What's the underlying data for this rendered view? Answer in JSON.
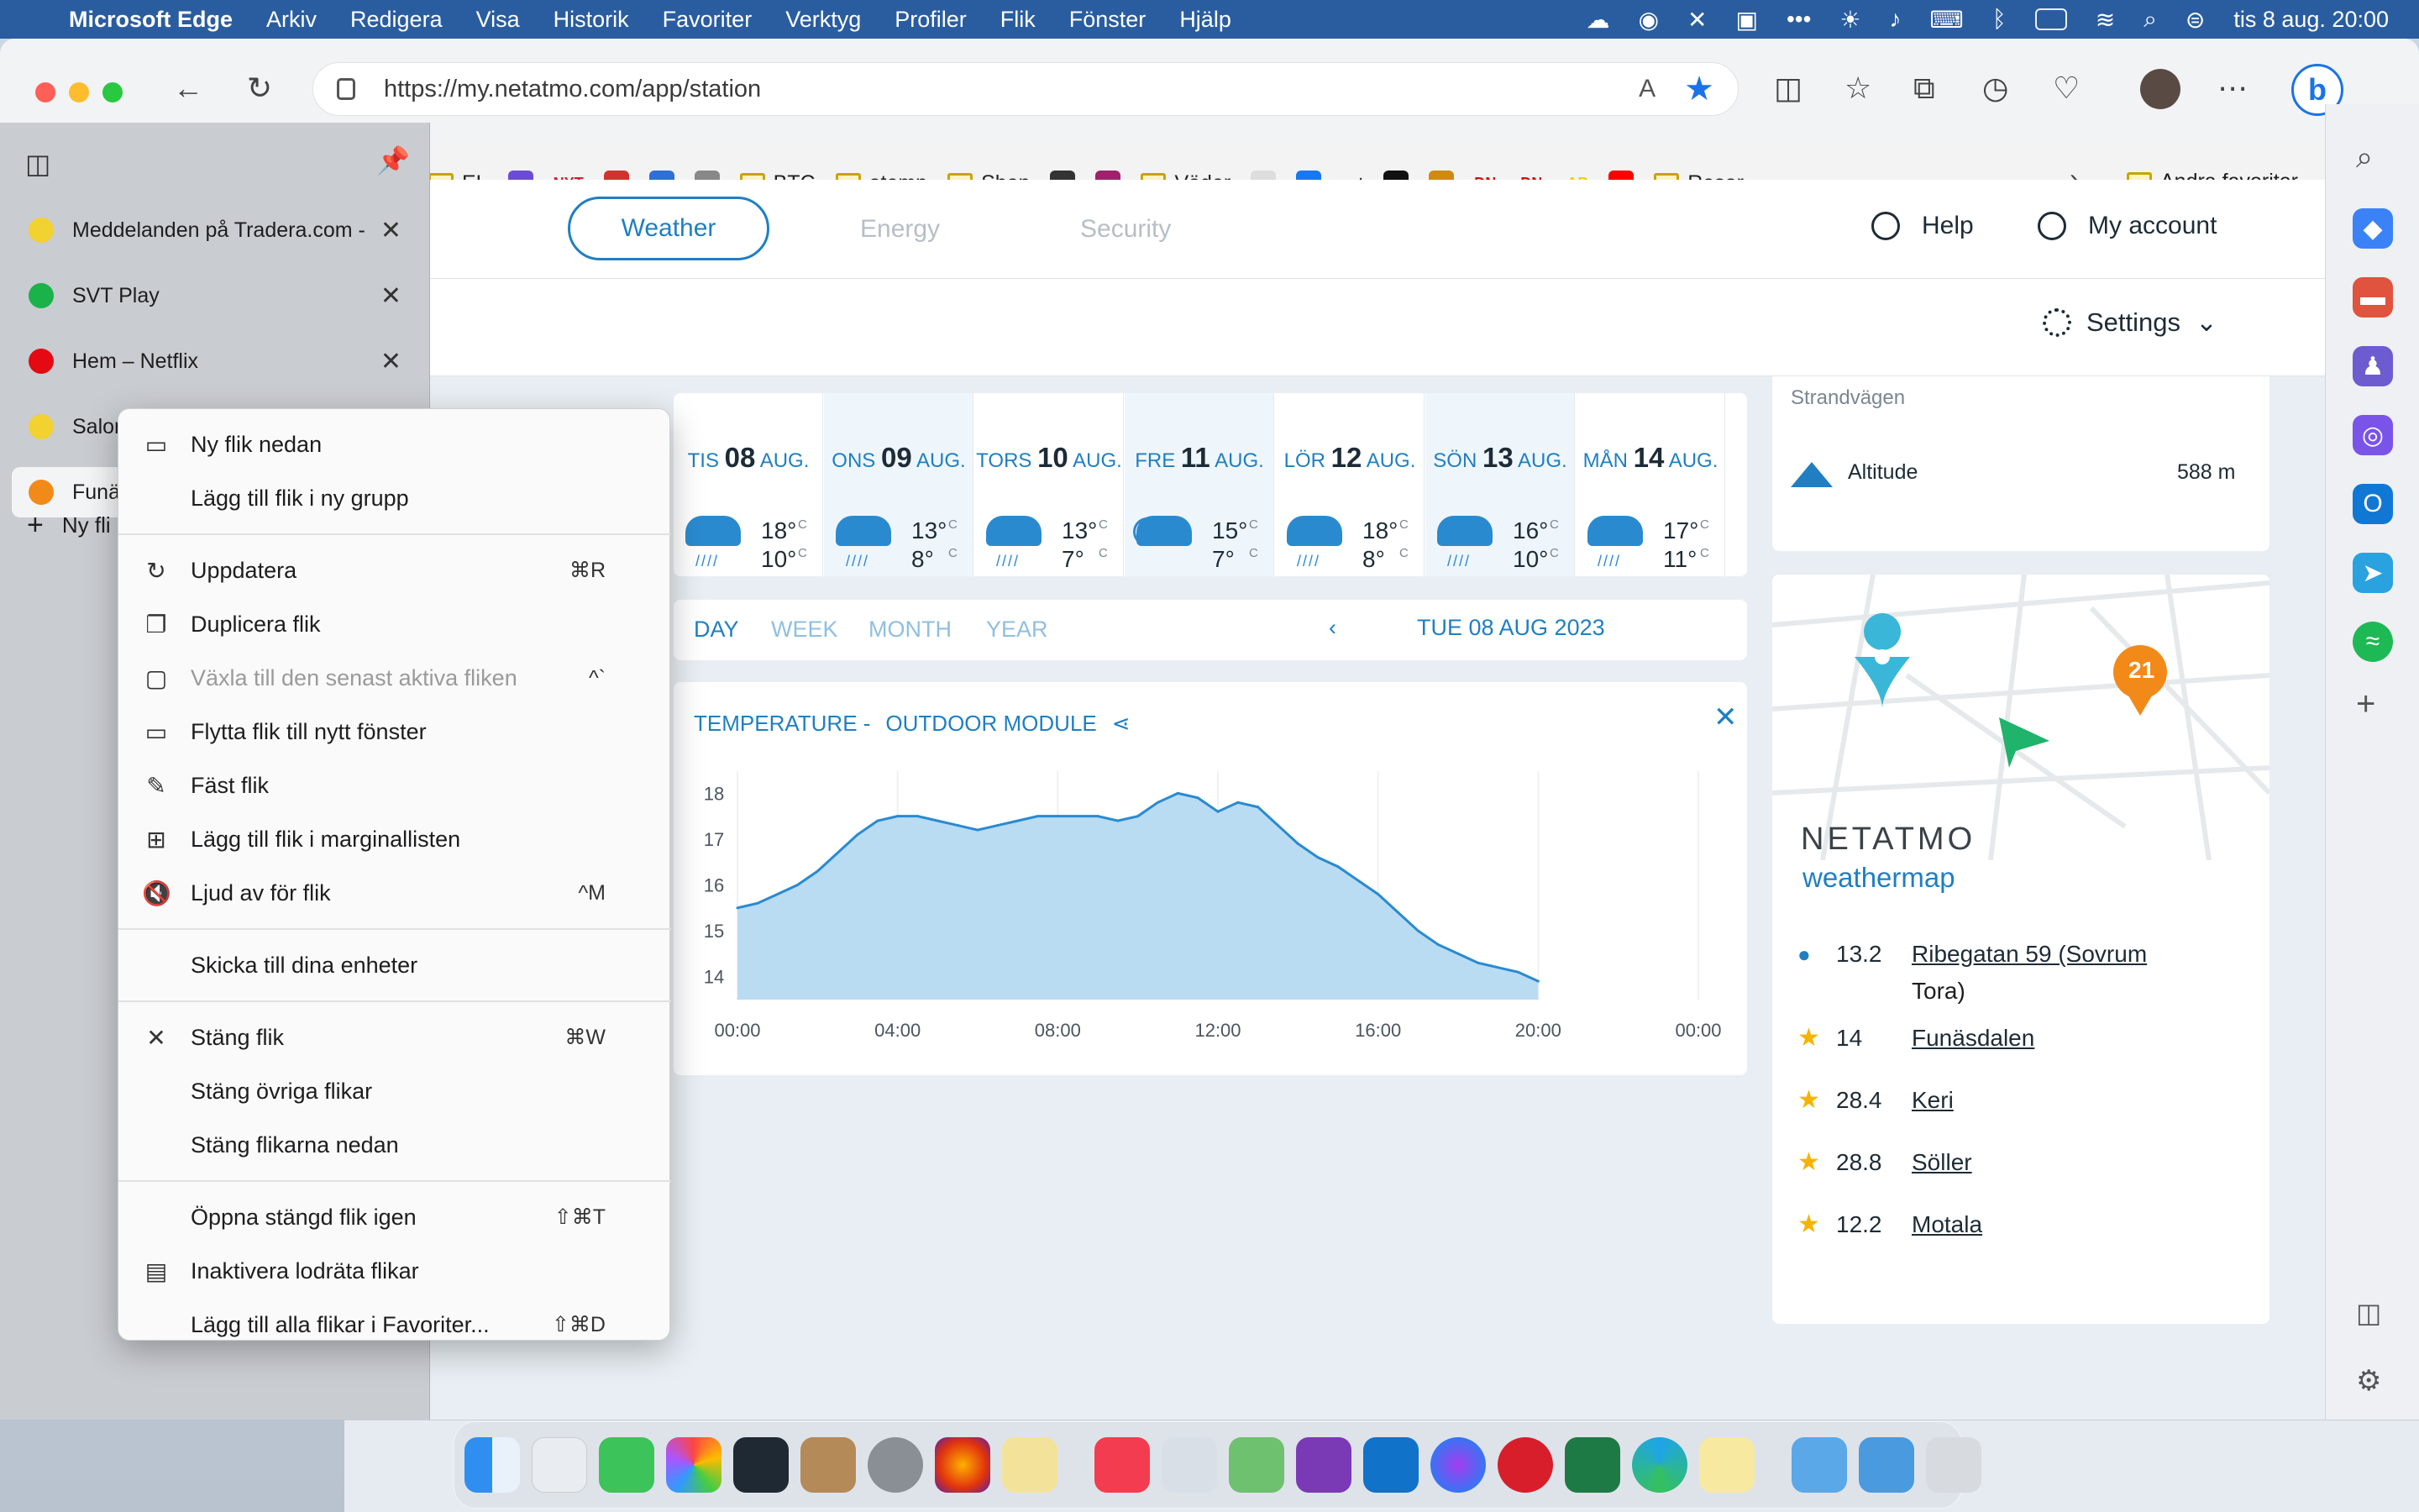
{
  "menubar": {
    "app_name": "Microsoft Edge",
    "items": [
      "Arkiv",
      "Redigera",
      "Visa",
      "Historik",
      "Favoriter",
      "Verktyg",
      "Profiler",
      "Flik",
      "Fönster",
      "Hjälp"
    ],
    "clock": "tis 8 aug. 20:00"
  },
  "browser": {
    "url": "https://my.netatmo.com/app/station",
    "read_aloud_label": "A",
    "favorites": [
      {
        "label": "EL",
        "type": "folder"
      },
      {
        "label": "",
        "type": "site",
        "color": "#6a4bd8"
      },
      {
        "label": "NYT",
        "type": "site",
        "color": "#d01f2f"
      },
      {
        "label": "",
        "type": "site",
        "color": "#d0342c"
      },
      {
        "label": "",
        "type": "site",
        "color": "#2f6fd8"
      },
      {
        "label": "",
        "type": "site",
        "color": "#888888"
      },
      {
        "label": "BTC",
        "type": "folder"
      },
      {
        "label": "atemp",
        "type": "folder"
      },
      {
        "label": "Shop",
        "type": "folder"
      },
      {
        "label": "",
        "type": "site",
        "color": "#333333"
      },
      {
        "label": "",
        "type": "site",
        "color": "#a0206e"
      },
      {
        "label": "Väder",
        "type": "folder"
      },
      {
        "label": "",
        "type": "site",
        "color": "#dddddd"
      },
      {
        "label": "",
        "type": "site",
        "color": "#1877f2"
      },
      {
        "label": "svt",
        "type": "site",
        "color": "#1e1e1e"
      },
      {
        "label": "",
        "type": "site",
        "color": "#111111"
      },
      {
        "label": "",
        "type": "site",
        "color": "#d08a10"
      },
      {
        "label": "DN.",
        "type": "site",
        "color": "#d01010"
      },
      {
        "label": "DN.",
        "type": "site",
        "color": "#d01010"
      },
      {
        "label": "AB",
        "type": "site",
        "color": "#f0d000"
      },
      {
        "label": "",
        "type": "site",
        "color": "#ff0000"
      },
      {
        "label": "Resor",
        "type": "folder"
      }
    ],
    "other_favorites": "Andra favoriter"
  },
  "tabs": [
    {
      "label": "Meddelanden på Tradera.com - ",
      "icon_color": "#f2d230"
    },
    {
      "label": "SVT Play",
      "icon_color": "#19b34a"
    },
    {
      "label": "Hem – Netflix",
      "icon_color": "#e50914"
    },
    {
      "label": "Salomon Vandringskänga Gore",
      "icon_color": "#f2d230"
    },
    {
      "label": "Funä",
      "icon_color": "#f28a1a"
    }
  ],
  "new_tab_label": "Ny fli",
  "context_menu": {
    "groups": [
      [
        {
          "label": "Ny flik nedan",
          "icon": "new-tab-icon",
          "glyph": "▭",
          "key": ""
        },
        {
          "label": "Lägg till flik i ny grupp",
          "icon": "",
          "glyph": "",
          "key": ""
        }
      ],
      [
        {
          "label": "Uppdatera",
          "icon": "refresh-icon",
          "glyph": "↻",
          "key": "⌘R"
        },
        {
          "label": "Duplicera flik",
          "icon": "duplicate-icon",
          "glyph": "❐",
          "key": ""
        },
        {
          "label": "Växla till den senast aktiva fliken",
          "icon": "switch-tab-icon",
          "glyph": "▢",
          "key": "^`",
          "disabled": true
        },
        {
          "label": "Flytta flik till nytt fönster",
          "icon": "window-icon",
          "glyph": "▭",
          "key": ""
        },
        {
          "label": "Fäst flik",
          "icon": "pin-icon",
          "glyph": "✎",
          "key": ""
        },
        {
          "label": "Lägg till flik i marginallisten",
          "icon": "sidebar-add-icon",
          "glyph": "⊞",
          "key": ""
        },
        {
          "label": "Ljud av för flik",
          "icon": "mute-icon",
          "glyph": "🔇",
          "key": "^M"
        }
      ],
      [
        {
          "label": "Skicka till dina enheter",
          "icon": "",
          "glyph": "",
          "key": ""
        }
      ],
      [
        {
          "label": "Stäng flik",
          "icon": "close-icon",
          "glyph": "✕",
          "key": "⌘W"
        },
        {
          "label": "Stäng övriga flikar",
          "icon": "",
          "glyph": "",
          "key": ""
        },
        {
          "label": "Stäng flikarna nedan",
          "icon": "",
          "glyph": "",
          "key": ""
        }
      ],
      [
        {
          "label": "Öppna stängd flik igen",
          "icon": "",
          "glyph": "",
          "key": "⇧⌘T"
        },
        {
          "label": "Inaktivera lodräta flikar",
          "icon": "vertical-tabs-icon",
          "glyph": "▤",
          "key": ""
        },
        {
          "label": "Lägg till alla flikar i Favoriter...",
          "icon": "",
          "glyph": "",
          "key": "⇧⌘D"
        }
      ]
    ]
  },
  "netatmo": {
    "nav_tabs": [
      "Weather",
      "Energy",
      "Security"
    ],
    "help": "Help",
    "account": "My account",
    "settings": "Settings",
    "forecast": [
      {
        "dow": "TIS",
        "day": "08",
        "mon": "AUG.",
        "max": "18°",
        "min": "10°",
        "icon": "rain"
      },
      {
        "dow": "ONS",
        "day": "09",
        "mon": "AUG.",
        "max": "13°",
        "min": "8°",
        "icon": "rain"
      },
      {
        "dow": "TORS",
        "day": "10",
        "mon": "AUG.",
        "max": "13°",
        "min": "7°",
        "icon": "rain"
      },
      {
        "dow": "FRE",
        "day": "11",
        "mon": "AUG.",
        "max": "15°",
        "min": "7°",
        "icon": "partly-cloudy"
      },
      {
        "dow": "LÖR",
        "day": "12",
        "mon": "AUG.",
        "max": "18°",
        "min": "8°",
        "icon": "rain"
      },
      {
        "dow": "SÖN",
        "day": "13",
        "mon": "AUG.",
        "max": "16°",
        "min": "10°",
        "icon": "rain"
      },
      {
        "dow": "MÅN",
        "day": "14",
        "mon": "AUG.",
        "max": "17°",
        "min": "11°",
        "icon": "rain"
      }
    ],
    "unit_c": "C",
    "periods": [
      "DAY",
      "WEEK",
      "MONTH",
      "YEAR"
    ],
    "date": "TUE 08 AUG 2023",
    "chart_title_a": "TEMPERATURE -",
    "chart_title_b": "OUTDOOR MODULE",
    "station": {
      "street": "Strandvägen",
      "altitude_label": "Altitude",
      "altitude_value": "588 m"
    },
    "weathermap": {
      "brand": "NETATMO",
      "sub": "weathermap",
      "marker_value": "21",
      "stations": [
        {
          "value": "13.2",
          "name": "Ribegatan 59 (Sovrum",
          "name2": "Tora)",
          "icon": "user"
        },
        {
          "value": "14",
          "name": "Funäsdalen",
          "icon": "star"
        },
        {
          "value": "28.4",
          "name": "Keri",
          "icon": "star"
        },
        {
          "value": "28.8",
          "name": "Söller",
          "icon": "star"
        },
        {
          "value": "12.2",
          "name": "Motala",
          "icon": "star"
        }
      ]
    }
  },
  "chart_data": {
    "type": "area",
    "title": "TEMPERATURE - OUTDOOR MODULE",
    "xlabel": "",
    "ylabel": "",
    "x_ticks": [
      "00:00",
      "04:00",
      "08:00",
      "12:00",
      "16:00",
      "20:00",
      "00:00"
    ],
    "y_ticks": [
      14,
      15,
      16,
      17,
      18
    ],
    "xlim_hours": [
      0,
      24
    ],
    "ylim": [
      13.5,
      18.3
    ],
    "grid": true,
    "series": [
      {
        "x": [
          0,
          0.5,
          1,
          1.5,
          2,
          2.5,
          3,
          3.5,
          4,
          4.5,
          5,
          5.5,
          6,
          6.5,
          7,
          7.5,
          8,
          8.5,
          9,
          9.5,
          10,
          10.5,
          11,
          11.5,
          12,
          12.5,
          13,
          13.5,
          14,
          14.5,
          15,
          15.5,
          16,
          16.5,
          17,
          17.5,
          18,
          18.5,
          19,
          19.5,
          20
        ],
        "y": [
          15.5,
          15.6,
          15.8,
          16.0,
          16.3,
          16.7,
          17.1,
          17.4,
          17.5,
          17.5,
          17.4,
          17.3,
          17.2,
          17.3,
          17.4,
          17.5,
          17.5,
          17.5,
          17.5,
          17.4,
          17.5,
          17.8,
          18.0,
          17.9,
          17.6,
          17.8,
          17.7,
          17.3,
          16.9,
          16.6,
          16.4,
          16.1,
          15.8,
          15.4,
          15.0,
          14.7,
          14.5,
          14.3,
          14.2,
          14.1,
          13.9
        ]
      }
    ]
  }
}
